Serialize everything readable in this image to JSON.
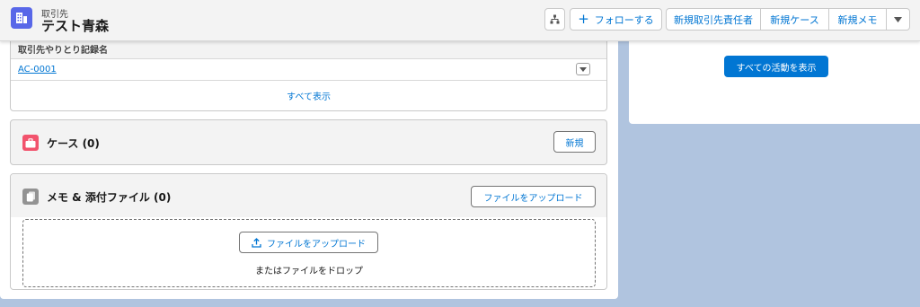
{
  "header": {
    "object_type": "取引先",
    "record_name": "テスト青森",
    "follow_label": "フォローする",
    "actions": [
      "新規取引先責任者",
      "新規ケース",
      "新規メモ"
    ]
  },
  "related_table": {
    "column_header": "取引先やりとり記録名",
    "rows": [
      {
        "name": "AC-0001"
      }
    ],
    "view_all": "すべて表示"
  },
  "cases": {
    "title": "ケース (0)",
    "new_label": "新規"
  },
  "files": {
    "title": "メモ & 添付ファイル (0)",
    "upload_label": "ファイルをアップロード",
    "drop_upload_label": "ファイルをアップロード",
    "drop_text": "またはファイルをドロップ"
  },
  "activity": {
    "view_all_label": "すべての活動を表示"
  },
  "colors": {
    "brand": "#0176d3",
    "account_icon": "#5867e8",
    "case_icon": "#f2536d",
    "files_icon": "#939393",
    "background": "#b0c4df"
  }
}
